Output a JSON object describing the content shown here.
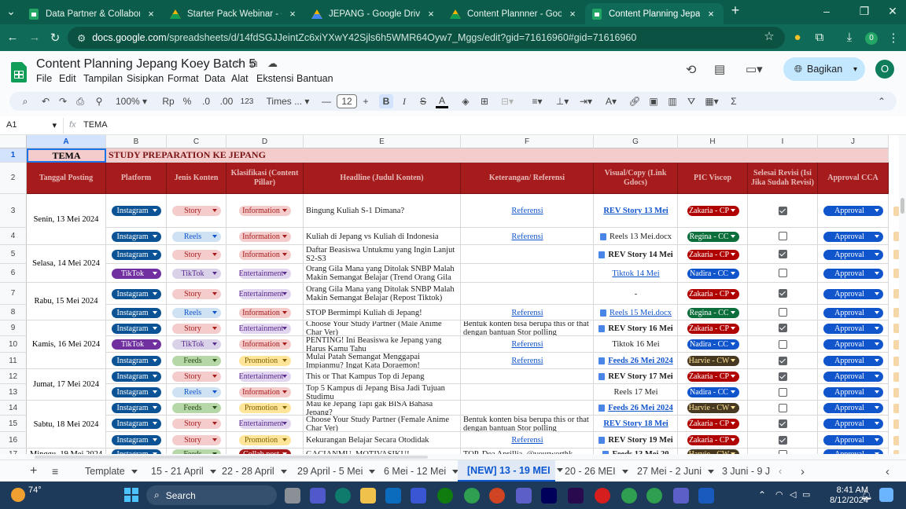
{
  "browser": {
    "tabs": [
      {
        "title": "Data Partner & Collaboration",
        "icon": "sheets-icon"
      },
      {
        "title": "Starter Pack Webinar - Google S",
        "icon": "drive-icon"
      },
      {
        "title": "JEPANG - Google Drive",
        "icon": "drive-icon"
      },
      {
        "title": "Content Plannner - Google Driv",
        "icon": "drive-icon"
      },
      {
        "title": "Content Planning Jepang Koey",
        "icon": "sheets-icon",
        "active": true
      }
    ],
    "url_host": "docs.google.com",
    "url_path": "/spreadsheets/d/14fdSGJJeintZc6xiYXwY42Sjls6h5WMR64Oyw7_Mggs/edit?gid=71616960#gid=71616960"
  },
  "doc": {
    "title": "Content Planning Jepang Koey Batch 5",
    "menu": [
      "File",
      "Edit",
      "Tampilan",
      "Sisipkan",
      "Format",
      "Data",
      "Alat",
      "Ekstensi",
      "Bantuan"
    ],
    "share_label": "Bagikan",
    "avatar_letter": "O"
  },
  "toolbar": {
    "zoom": "100%",
    "currency": "Rp",
    "percent": "%",
    "dec_less": ".0",
    "dec_more": ".00",
    "number_fmt": "123",
    "font": "Times ...",
    "font_size": "12"
  },
  "formula_bar": {
    "cell_ref": "A1",
    "fx": "fx",
    "content": "TEMA"
  },
  "columns": [
    "A",
    "B",
    "C",
    "D",
    "E",
    "F",
    "G",
    "H",
    "I",
    "J"
  ],
  "sheet": {
    "row1": {
      "a": "TEMA",
      "b": "STUDY PREPARATION KE JEPANG"
    },
    "headers": [
      "Tanggal Posting",
      "Platform",
      "Jenis Konten",
      "Klasifikasi (Content Pillar)",
      "Headline (Judul Konten)",
      "Keterangan/ Referensi",
      "Visual/Copy (Link Gdocs)",
      "PIC Viscop",
      "Selesai Revisi (Isi Jika Sudah Revisi)",
      "Approval CCA"
    ],
    "row_numbers": [
      "1",
      "2",
      "3",
      "4",
      "5",
      "6",
      "7",
      "8",
      "9",
      "10",
      "11",
      "12",
      "13",
      "14",
      "15",
      "16",
      "17"
    ],
    "dates": [
      {
        "label": "Senin, 13 Mei 2024"
      },
      {
        "label": "Selasa, 14 Mei 2024"
      },
      {
        "label": "Rabu, 15 Mei 2024"
      },
      {
        "label": "Kamis, 16 Mei 2024"
      },
      {
        "label": "Jumat, 17 Mei 2024"
      },
      {
        "label": "Sabtu, 18 Mei 2024"
      },
      {
        "label": "Minggu, 19 Mei 2024"
      }
    ],
    "rows": [
      {
        "platform": "Instagram",
        "jenis": "Story",
        "klas": "Information",
        "headline": "Bingung Kuliah S-1 Dimana?",
        "ref": "Referensi",
        "visual": "REV Story 13 Mei",
        "pic": "Zakaria - CP",
        "done": true,
        "approval": "Approval"
      },
      {
        "platform": "Instagram",
        "jenis": "Reels",
        "klas": "Information",
        "headline": "Kuliah di Jepang vs Kuliah di Indonesia",
        "ref": "Referensi",
        "visual": "Reels 13 Mei.docx",
        "pic": "Regina - CC",
        "done": false,
        "approval": "Approval"
      },
      {
        "platform": "Instagram",
        "jenis": "Story",
        "klas": "Information",
        "headline": "Daftar Beasiswa Untukmu yang Ingin Lanjut S2-S3",
        "ref": "",
        "visual": "REV Story 14 Mei",
        "pic": "Zakaria - CP",
        "done": true,
        "approval": "Approval"
      },
      {
        "platform": "TikTok",
        "jenis": "TikTok",
        "klas": "Entertainment",
        "headline": "Orang Gila Mana yang Ditolak SNBP Malah Makin Semangat Belajar (Trend Orang Gila",
        "ref": "",
        "visual": "Tiktok 14 Mei",
        "pic": "Nadira - CC",
        "done": false,
        "approval": "Approval"
      },
      {
        "platform": "Instagram",
        "jenis": "Story",
        "klas": "Entertainment",
        "headline": "Orang Gila Mana yang Ditolak SNBP Malah Makin Semangat Belajar (Repost Tiktok)",
        "ref": "",
        "visual": "-",
        "pic": "Zakaria - CP",
        "done": true,
        "approval": "Approval"
      },
      {
        "platform": "Instagram",
        "jenis": "Reels",
        "klas": "Information",
        "headline": "STOP Bermimpi Kuliah di Jepang!",
        "ref": "Referensi",
        "visual": "Reels 15 Mei.docx",
        "pic": "Regina - CC",
        "done": false,
        "approval": "Approval"
      },
      {
        "platform": "Instagram",
        "jenis": "Story",
        "klas": "Entertainment",
        "headline": "Choose Your Study Partner (Male Anime Char Ver)",
        "ref": "Bentuk konten bisa berupa this or that dengan bantuan Stor polling",
        "visual": "REV Story 16 Mei",
        "pic": "Zakaria - CP",
        "done": true,
        "approval": "Approval"
      },
      {
        "platform": "TikTok",
        "jenis": "TikTok",
        "klas": "Information",
        "headline": "PENTING! Ini Beasiswa ke Jepang yang Harus Kamu Tahu",
        "ref": "Referensi",
        "visual": "Tiktok 16 Mei",
        "pic": "Nadira - CC",
        "done": false,
        "approval": "Approval"
      },
      {
        "platform": "Instagram",
        "jenis": "Feeds",
        "klas": "Promotion",
        "headline": "Mulai Patah Semangat Menggapai Impianmu? Ingat Kata Doraemon!",
        "ref": "Referensi",
        "visual": "Feeds 26 Mei 2024",
        "pic": "Harvie - CW",
        "done": true,
        "approval": "Approval"
      },
      {
        "platform": "Instagram",
        "jenis": "Story",
        "klas": "Entertainment",
        "headline": "This or That Kampus Top di Jepang",
        "ref": "",
        "visual": "REV Story 17 Mei",
        "pic": "Zakaria - CP",
        "done": true,
        "approval": "Approval"
      },
      {
        "platform": "Instagram",
        "jenis": "Reels",
        "klas": "Information",
        "headline": "Top 5 Kampus di Jepang Bisa Jadi Tujuan Studimu",
        "ref": "",
        "visual": "Reels 17 Mei",
        "pic": "Nadira - CC",
        "done": false,
        "approval": "Approval"
      },
      {
        "platform": "Instagram",
        "jenis": "Feeds",
        "klas": "Promotion",
        "headline": "Mau ke Jepang Tapi gak BISA Bahasa Jepang?",
        "ref": "",
        "visual": "Feeds 26 Mei 2024",
        "pic": "Harvie - CW",
        "done": false,
        "approval": "Approval"
      },
      {
        "platform": "Instagram",
        "jenis": "Story",
        "klas": "Entertainment",
        "headline": "Choose Your Study Partner (Female Anime Char Ver)",
        "ref": "Bentuk konten bisa berupa this or that dengan bantuan Stor polling",
        "visual": "REV Story 18 Mei",
        "pic": "Zakaria - CP",
        "done": true,
        "approval": "Approval"
      },
      {
        "platform": "Instagram",
        "jenis": "Story",
        "klas": "Promotion",
        "headline": "Kekurangan Belajar Secara Otodidak",
        "ref": "Referensi",
        "visual": "REV Story 19 Mei",
        "pic": "Zakaria - CP",
        "done": true,
        "approval": "Approval"
      },
      {
        "platform": "Instagram",
        "jenis": "Feeds",
        "klas": "Collab post",
        "headline": "GACIANMU, MOTIVASIKU!",
        "ref": "TOP, Dea Aprillia, @yourworthk",
        "visual": "Feeds 13 Mei 20",
        "pic": "Harvie - CW",
        "done": false,
        "approval": "Approval"
      }
    ]
  },
  "sheet_tabs": [
    "Template",
    "15 - 21 April",
    "22 - 28 April",
    "29 April - 5 Mei",
    "6 Mei - 12 Mei",
    "[NEW] 13 - 19 MEI",
    "20 - 26 MEI",
    "27 Mei - 2 Juni",
    "3 Juni - 9 J"
  ],
  "active_sheet": "[NEW] 13 - 19 MEI",
  "taskbar": {
    "weather": "74°",
    "search": "Search",
    "time": "8:41 AM",
    "date": "8/12/2024"
  },
  "colors": {
    "header_red": "#a61c1c",
    "row1_bg": "#f4cccc",
    "instagram_chip": "#0b5394",
    "tiktok_chip": "#9900ff",
    "approval_chip": "#1155cc"
  }
}
